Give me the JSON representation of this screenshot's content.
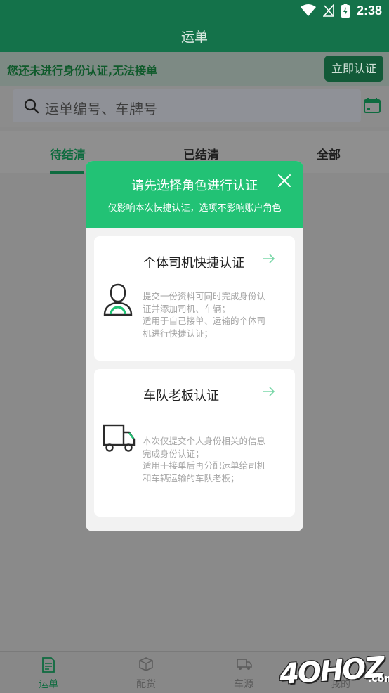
{
  "status_bar": {
    "time": "2:38",
    "icons": [
      "wifi-icon",
      "signal-icon",
      "battery-charging-icon"
    ]
  },
  "header": {
    "title": "运单"
  },
  "notice": {
    "text": "您还未进行身份认证,无法接单",
    "button_label": "立即认证"
  },
  "search": {
    "placeholder": "运单编号、车牌号",
    "icon": "search-icon",
    "calendar_icon": "calendar-icon"
  },
  "tabs": [
    {
      "label": "待结清",
      "active": true
    },
    {
      "label": "已结清",
      "active": false
    },
    {
      "label": "全部",
      "active": false
    }
  ],
  "modal": {
    "title": "请先选择角色进行认证",
    "subtitle": "仅影响本次快捷认证，选项不影响账户角色",
    "cards": [
      {
        "title": "个体司机快捷认证",
        "icon": "driver-icon",
        "desc_lines": [
          "提交一份资料可同时完成身份认",
          "证并添加司机、车辆；",
          "适用于自己接单、运输的个体司",
          "机进行快捷认证；"
        ]
      },
      {
        "title": "车队老板认证",
        "icon": "truck-icon",
        "desc_lines": [
          "本次仅提交个人身份相关的信息",
          "完成身份认证；",
          "适用于接单后再分配运单给司机",
          "和车辆运输的车队老板；"
        ]
      }
    ]
  },
  "bottom_nav": [
    {
      "label": "运单",
      "icon": "waybill-icon",
      "active": true
    },
    {
      "label": "配货",
      "icon": "box-icon",
      "active": false
    },
    {
      "label": "车源",
      "icon": "truck-nav-icon",
      "active": false
    },
    {
      "label": "我的",
      "icon": "user-icon",
      "active": false
    }
  ],
  "watermark": {
    "text": "4OHOZ",
    "suffix": ".com"
  },
  "colors": {
    "brand_green": "#22c275",
    "header_green": "#14724a",
    "dim_overlay": "#8a8a8a"
  }
}
